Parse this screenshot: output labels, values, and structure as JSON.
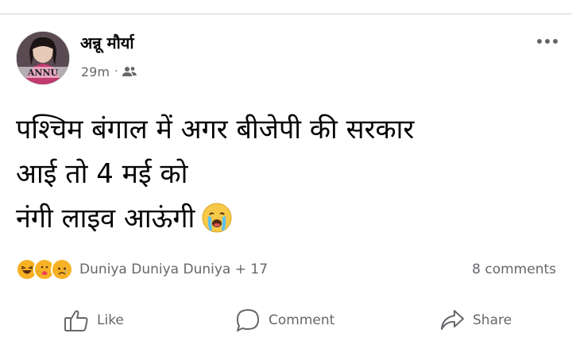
{
  "post": {
    "author_name": "अन्नू मौर्या",
    "avatar_caption": "ANNU",
    "timestamp": "29m",
    "separator": "·",
    "audience_icon": "friends-icon",
    "more_icon": "more-horizontal-icon",
    "text_lines": [
      "पश्चिम बंगाल में अगर बीजेपी की सरकार",
      "आई तो 4 मई को",
      "नंगी लाइव आऊंगी"
    ],
    "text_emoji": "crying-face-icon"
  },
  "reactions": {
    "icons": [
      "haha-icon",
      "care-icon",
      "sad-icon"
    ],
    "names": "Duniya Duniya Duniya + 17",
    "comments": "8 comments"
  },
  "actions": {
    "like": "Like",
    "comment": "Comment",
    "share": "Share"
  },
  "colors": {
    "text": "#050505",
    "secondary": "#65676b",
    "divider": "#cfd2d6"
  }
}
